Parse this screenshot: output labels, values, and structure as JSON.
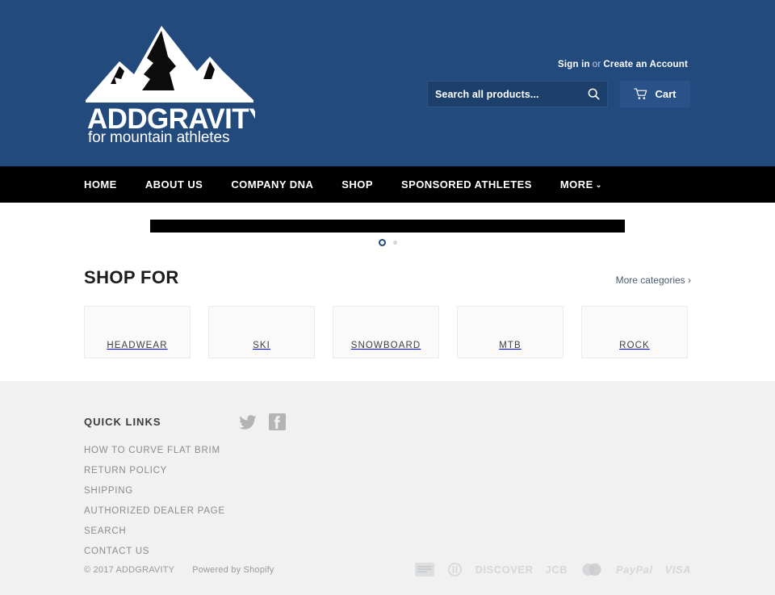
{
  "site": {
    "brand_name": "ADDGRAVITY",
    "brand_tagline": "for mountain athletes",
    "header_bg": "#234a7d",
    "nav_bg": "#010101",
    "footer_bg": "#f1f1f1"
  },
  "account": {
    "sign_in": "Sign in",
    "separator": "or",
    "create_account": "Create an Account"
  },
  "search": {
    "placeholder": "Search all products...",
    "value": "",
    "icon": "search-icon"
  },
  "cart": {
    "label": "Cart",
    "icon": "shopping-cart-icon"
  },
  "nav": {
    "items": [
      {
        "label": "HOME",
        "has_caret": false
      },
      {
        "label": "ABOUT US",
        "has_caret": false
      },
      {
        "label": "COMPANY DNA",
        "has_caret": false
      },
      {
        "label": "SHOP",
        "has_caret": false
      },
      {
        "label": "SPONSORED ATHLETES",
        "has_caret": false
      },
      {
        "label": "MORE",
        "has_caret": true,
        "caret": "⌄"
      }
    ]
  },
  "slideshow": {
    "slide_count": 2,
    "active_index": 0
  },
  "shop": {
    "title": "SHOP FOR",
    "more_link": "More categories ›",
    "categories": [
      {
        "label": "HEADWEAR"
      },
      {
        "label": "SKI"
      },
      {
        "label": "SNOWBOARD"
      },
      {
        "label": "MTB"
      },
      {
        "label": "ROCK"
      }
    ]
  },
  "footer": {
    "quick_links_title": "QUICK LINKS",
    "quick_links": [
      "HOW TO CURVE FLAT BRIM",
      "RETURN POLICY",
      "SHIPPING",
      "AUTHORIZED DEALER PAGE",
      "SEARCH",
      "CONTACT US"
    ],
    "social": [
      {
        "name": "twitter-icon",
        "title": "Twitter"
      },
      {
        "name": "facebook-icon",
        "title": "Facebook"
      }
    ],
    "copyright": "© 2017 ADDGRAVITY",
    "powered_by": "Powered by Shopify",
    "payments": [
      {
        "name": "american-express-icon",
        "label": "American Express"
      },
      {
        "name": "diners-club-icon",
        "label": "Diners Club"
      },
      {
        "name": "discover-icon",
        "label": "DISCOVER"
      },
      {
        "name": "jcb-icon",
        "label": "JCB"
      },
      {
        "name": "mastercard-icon",
        "label": "Mastercard"
      },
      {
        "name": "paypal-icon",
        "label": "PayPal"
      },
      {
        "name": "visa-icon",
        "label": "VISA"
      }
    ]
  }
}
